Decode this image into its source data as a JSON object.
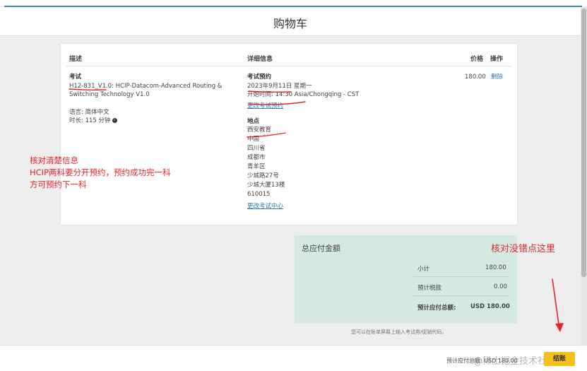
{
  "page": {
    "title": "购物车"
  },
  "table": {
    "headers": {
      "description": "描述",
      "details": "详细信息",
      "price": "价格",
      "action": "操作"
    },
    "exam": {
      "label": "考试",
      "name_line1": "H12-831_V1.0: HCIP-Datacom-Advanced Routing &",
      "name_line2": "Switching Technology V1.0",
      "language": "语言: 简体中文",
      "duration": "时长: 115 分钟"
    },
    "appointment": {
      "label": "考试预约",
      "date": "2023年9月11日 星期一",
      "start_time": "开始时间: 14:30 Asia/Chongqing - CST",
      "change_link": "更改考试预约"
    },
    "location": {
      "label": "地点",
      "lines": [
        "西安教育",
        "中国",
        "四川省",
        "成都市",
        "青羊区",
        "少城路27号",
        "少城大厦13楼",
        "610015"
      ],
      "change_link": "更改考试中心"
    },
    "price": "180.00",
    "delete_link": "删除"
  },
  "summary": {
    "title": "总应付金额",
    "subtotal_label": "小计",
    "subtotal_value": "180.00",
    "tax_label": "预计税款",
    "tax_value": "0.00",
    "total_label": "预计应付总额:",
    "total_value": "USD 180.00"
  },
  "footnote": "您可以在账单屏幕上输入考试券/促销代码。",
  "footer": {
    "text": "预计应付总额: USD 180.00",
    "checkout_label": "结账"
  },
  "watermark": "@稀土掘金技术社区",
  "annotations": {
    "left_note": [
      "核对清楚信息",
      "HCIP两科要分开预约，预约成功完一科",
      "方可预约下一科"
    ],
    "right_note": "核对没错点这里"
  },
  "colors": {
    "accent": "#3c8fa5",
    "summary_bg": "#d3e9e2",
    "cta": "#f3c11c",
    "annotation": "#e8242b"
  }
}
